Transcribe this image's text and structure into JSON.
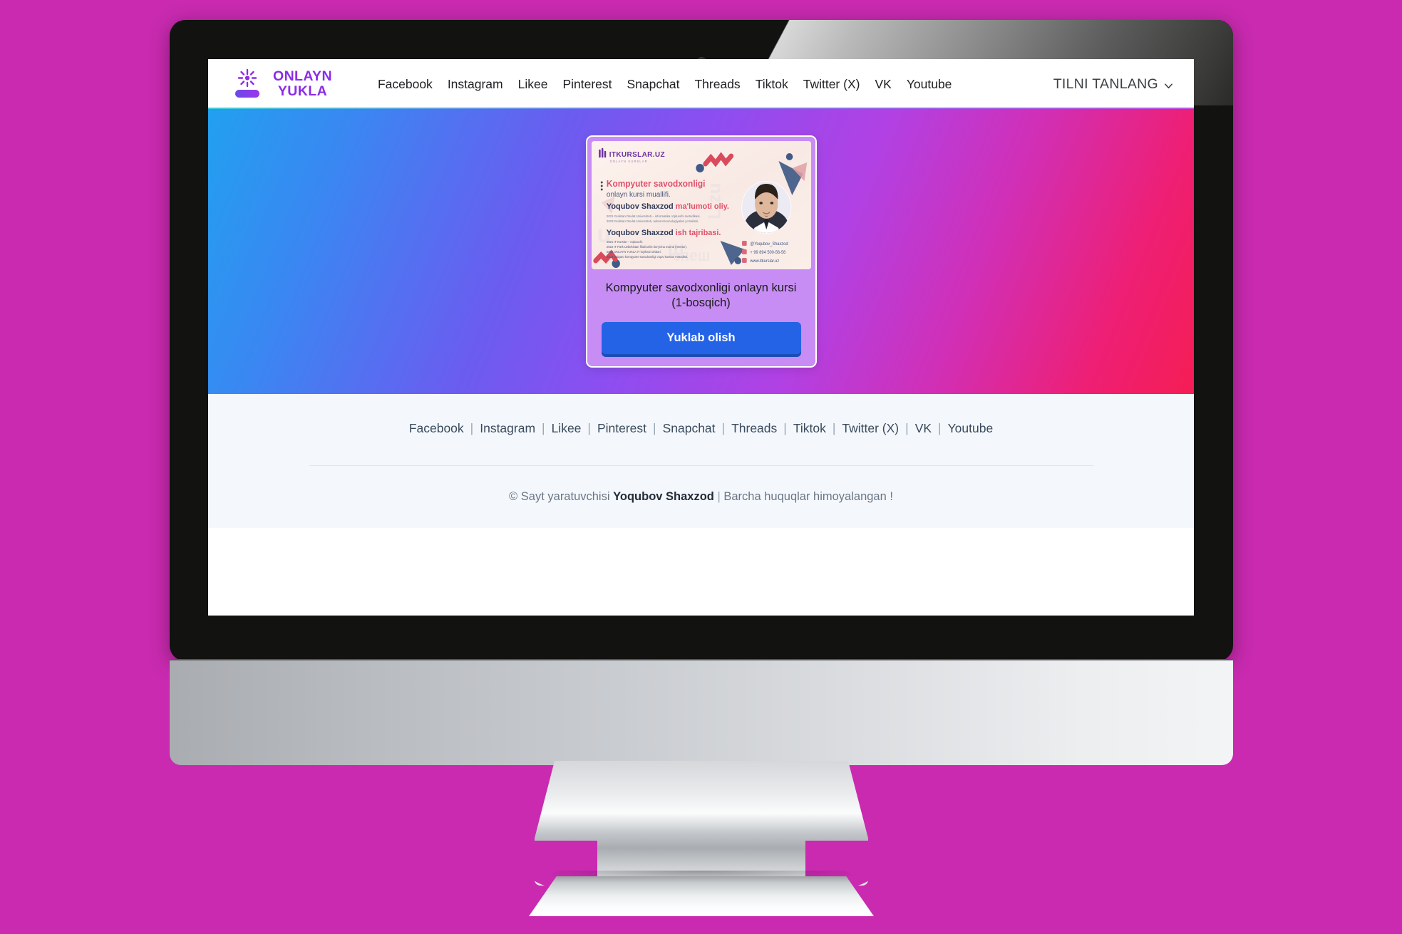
{
  "site": {
    "logo": {
      "line1": "ONLAYN",
      "line2": "YUKLA",
      "icon": "sparkle-logo-icon",
      "color": "#8c2ce8"
    }
  },
  "header": {
    "nav": [
      {
        "label": "Facebook"
      },
      {
        "label": "Instagram"
      },
      {
        "label": "Likee"
      },
      {
        "label": "Pinterest"
      },
      {
        "label": "Snapchat"
      },
      {
        "label": "Threads"
      },
      {
        "label": "Tiktok"
      },
      {
        "label": "Twitter (X)"
      },
      {
        "label": "VK"
      },
      {
        "label": "Youtube"
      }
    ],
    "language_selector": {
      "label": "TILNI TANLANG",
      "icon": "chevron-down-icon"
    }
  },
  "hero": {
    "gradient_from": "#22a0ef",
    "gradient_mid": "#8f4df0",
    "gradient_to": "#f51d55",
    "card": {
      "background": "#c78df4",
      "title": "Kompyuter savodxonligi onlayn kursi (1-bosqich)",
      "download_button": "Yuklab olish",
      "button_color": "#2563e6",
      "thumbnail": {
        "brand": "ITKURSLAR.UZ",
        "heading_1": "Kompyuter savodxonligi",
        "heading_2": "onlayn kursi muallifi.",
        "heading_3_name": "Yoqubov Shaxzod",
        "heading_3_rest": "ma'lumoti oliy.",
        "heading_4_name": "Yoqubov Shaxzod",
        "heading_4_rest": "ish tajribasi.",
        "contact_handle": "@Yoqubov_Shaxzod",
        "contact_phone": "+ 99 894 500-56-56",
        "contact_site": "www.itkurslar.uz"
      }
    }
  },
  "footer": {
    "links": [
      {
        "label": "Facebook"
      },
      {
        "label": "Instagram"
      },
      {
        "label": "Likee"
      },
      {
        "label": "Pinterest"
      },
      {
        "label": "Snapchat"
      },
      {
        "label": "Threads"
      },
      {
        "label": "Tiktok"
      },
      {
        "label": "Twitter (X)"
      },
      {
        "label": "VK"
      },
      {
        "label": "Youtube"
      }
    ],
    "separator": "|",
    "copyright_prefix": "© Sayt yaratuvchisi",
    "copyright_author": "Yoqubov Shaxzod",
    "copyright_bar": "|",
    "copyright_suffix": "Barcha huquqlar himoyalangan !"
  },
  "device": {
    "page_background": "#c92ab0",
    "bezel_color": "#121210"
  }
}
